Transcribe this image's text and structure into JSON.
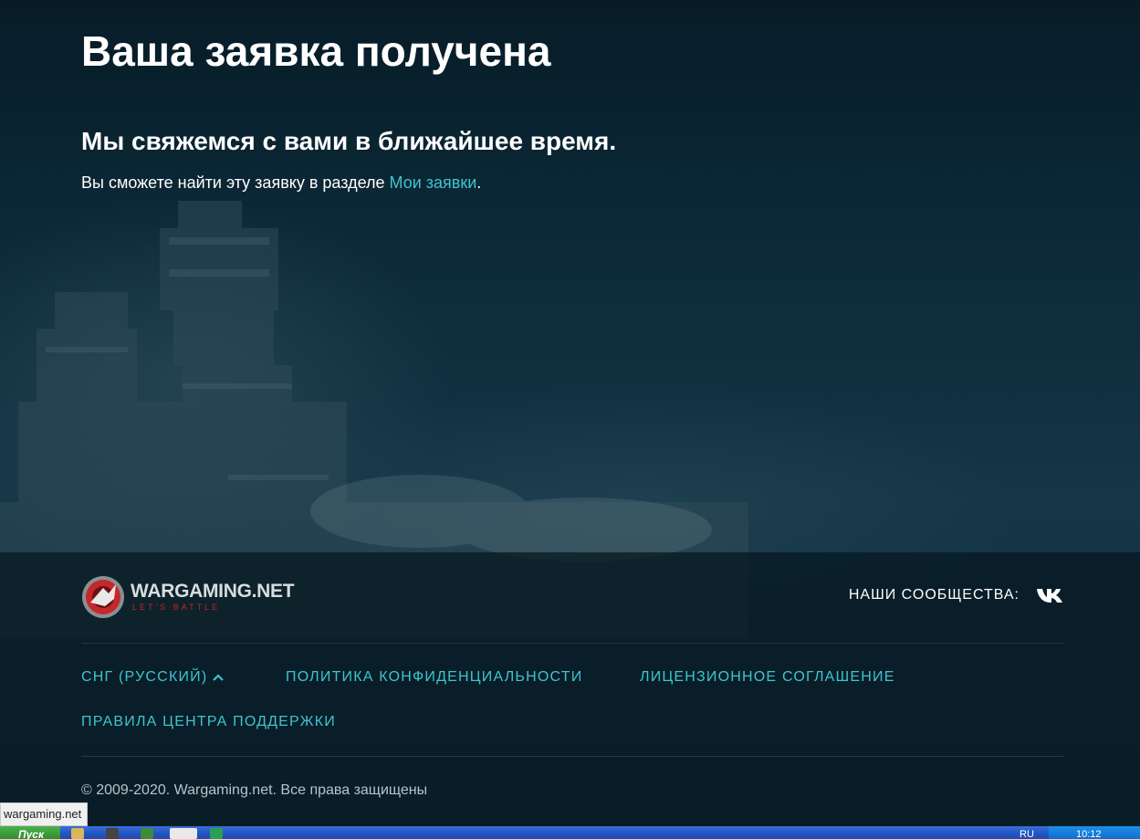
{
  "main": {
    "title": "Ваша заявка получена",
    "subtitle": "Мы свяжемся с вами в ближайшее время.",
    "info_prefix": "Вы сможете найти эту заявку в разделе ",
    "info_link": "Мои заявки",
    "info_suffix": "."
  },
  "footer": {
    "logo_name": "WARGAMING.NET",
    "logo_tagline": "LET'S BATTLE",
    "community_label": "НАШИ СООБЩЕСТВА:",
    "community_icon": "vk-icon",
    "links": {
      "region": "СНГ (РУССКИЙ)",
      "privacy": "ПОЛИТИКА КОНФИДЕНЦИАЛЬНОСТИ",
      "license": "ЛИЦЕНЗИОННОЕ СОГЛАШЕНИЕ",
      "support_rules": "ПРАВИЛА ЦЕНТРА ПОДДЕРЖКИ"
    },
    "copyright": "© 2009-2020. Wargaming.net. Все права защищены"
  },
  "browser": {
    "status_url": "wargaming.net"
  },
  "taskbar": {
    "start_label": "Пуск",
    "language": "RU",
    "clock": "10:12"
  },
  "colors": {
    "accent_link": "#3fc4d0",
    "background": "#0f2733",
    "logo_tagline": "#c0262b"
  }
}
